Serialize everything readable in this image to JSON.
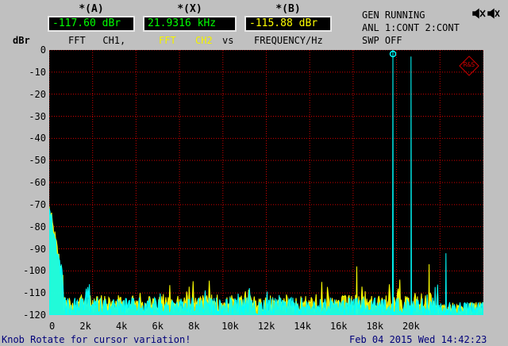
{
  "cursors": [
    {
      "title": "*(A)",
      "value": "-117.60 dBr",
      "value_color": "#00ff00"
    },
    {
      "title": "*(X)",
      "value": "21.9316 kHz",
      "value_color": "#00ff00"
    },
    {
      "title": "*(B)",
      "value": "-115.88 dBr",
      "value_color": "#ffff00"
    }
  ],
  "subheader": {
    "a": "FFT   CH1,",
    "x_fft": "FFT",
    "x_ch2": "CH2",
    "x_vs": "vs",
    "b": "FREQUENCY/Hz"
  },
  "status": {
    "line1": "GEN RUNNING",
    "line2": "ANL 1:CONT 2:CONT",
    "line3": "SWP OFF"
  },
  "chart_data": {
    "type": "line",
    "ylabel": "dBr",
    "ylim": [
      -120,
      0
    ],
    "xlim": [
      0,
      24000
    ],
    "yticks": [
      "0",
      "-10",
      "-20",
      "-30",
      "-40",
      "-50",
      "-60",
      "-70",
      "-80",
      "-90",
      "-100",
      "-110",
      "-120"
    ],
    "xticks": [
      "0",
      "2k",
      "4k",
      "6k",
      "8k",
      "10k",
      "12k",
      "14k",
      "16k",
      "18k",
      "20k"
    ],
    "grid": true,
    "series": [
      {
        "color": "#00ffff",
        "peaks": [
          [
            19000,
            0
          ],
          [
            20000,
            -3
          ],
          [
            21931,
            -92
          ]
        ]
      },
      {
        "color": "#ffff00",
        "peaks": [
          [
            17000,
            -98
          ],
          [
            19000,
            -95
          ],
          [
            21000,
            -97
          ]
        ]
      }
    ]
  },
  "footer": {
    "left": "Knob Rotate for cursor variation!",
    "right": "Feb 04 2015 Wed 14:42:23"
  },
  "logo": "R&S",
  "colors": {
    "trace1": "#00ffff",
    "trace2": "#ffff00",
    "grid": "#d00000"
  }
}
